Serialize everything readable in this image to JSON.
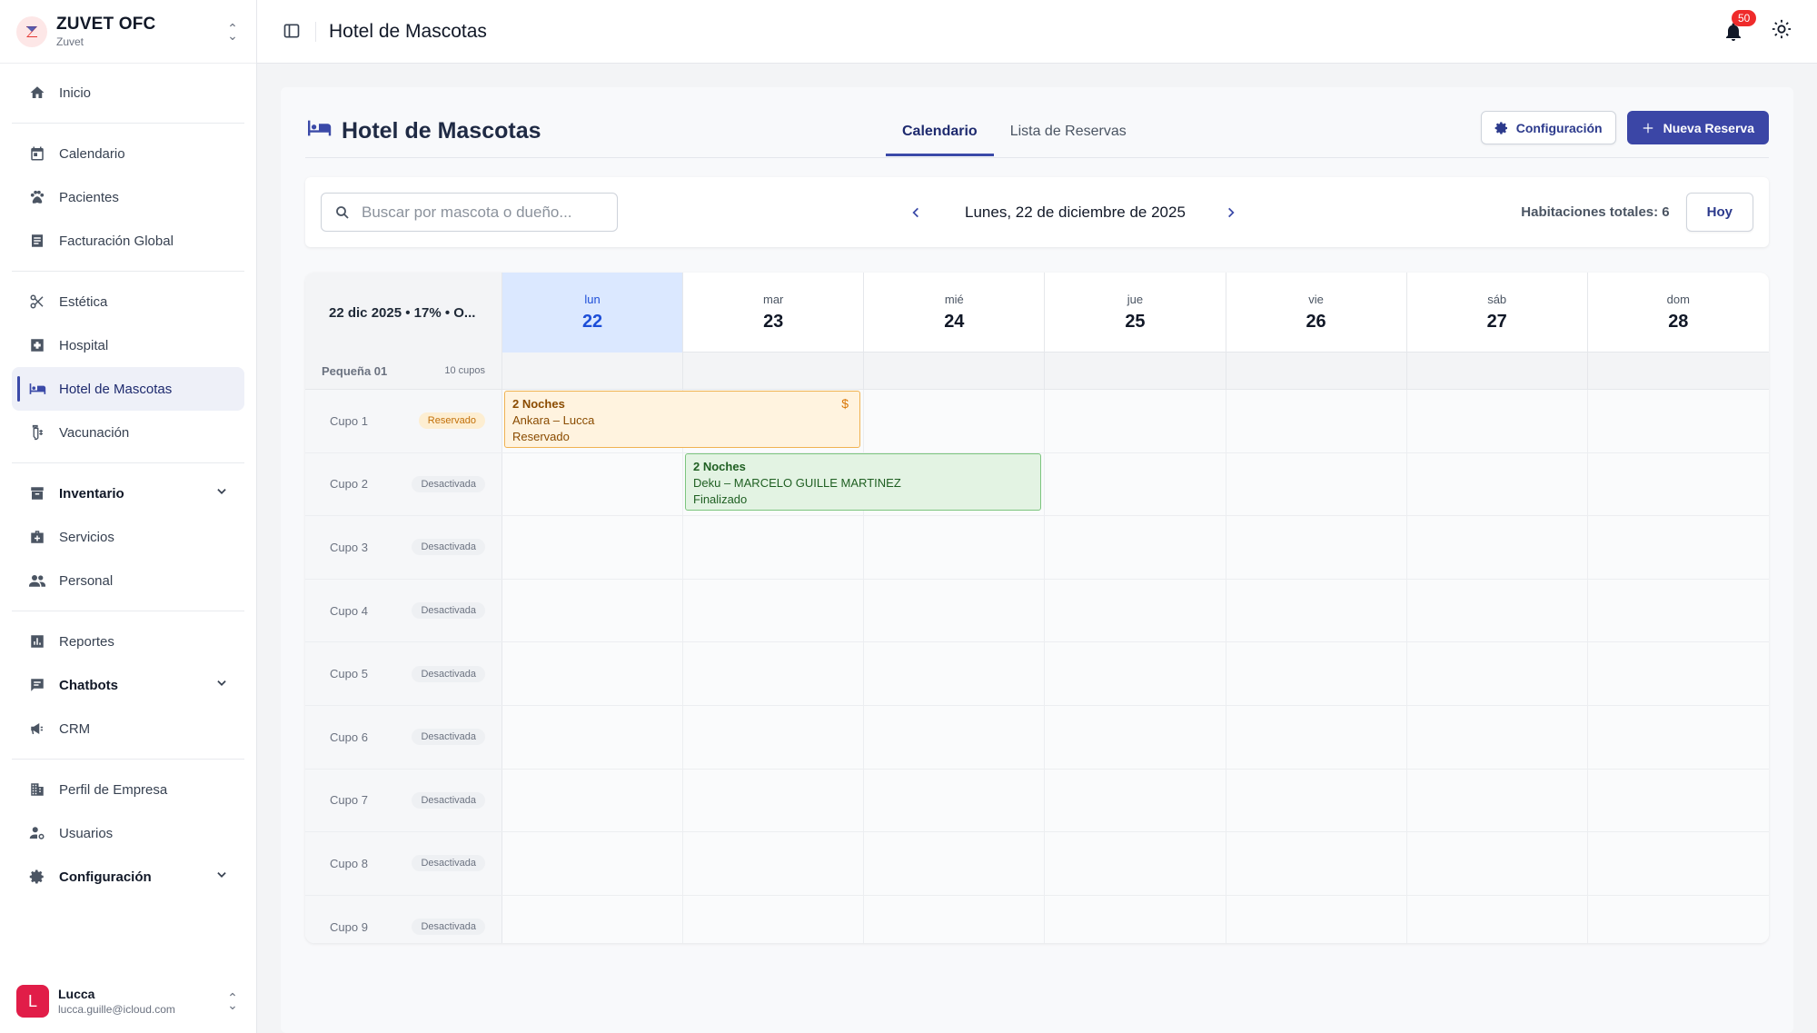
{
  "brand": {
    "title": "ZUVET OFC",
    "subtitle": "Zuvet"
  },
  "topbar": {
    "title": "Hotel de Mascotas",
    "notifications": "50"
  },
  "sidebar": {
    "items": [
      {
        "label": "Inicio",
        "icon": "home-icon"
      },
      {
        "label": "Calendario",
        "icon": "calendar-icon"
      },
      {
        "label": "Pacientes",
        "icon": "paw-icon"
      },
      {
        "label": "Facturación Global",
        "icon": "receipt-icon"
      },
      {
        "label": "Estética",
        "icon": "scissors-icon"
      },
      {
        "label": "Hospital",
        "icon": "hospital-icon"
      },
      {
        "label": "Hotel de Mascotas",
        "icon": "bed-icon"
      },
      {
        "label": "Vacunación",
        "icon": "syringe-icon"
      },
      {
        "label": "Inventario",
        "icon": "inventory-icon"
      },
      {
        "label": "Servicios",
        "icon": "medkit-icon"
      },
      {
        "label": "Personal",
        "icon": "people-icon"
      },
      {
        "label": "Reportes",
        "icon": "chart-icon"
      },
      {
        "label": "Chatbots",
        "icon": "chat-icon"
      },
      {
        "label": "CRM",
        "icon": "megaphone-icon"
      },
      {
        "label": "Perfil de Empresa",
        "icon": "building-icon"
      },
      {
        "label": "Usuarios",
        "icon": "user-settings-icon"
      },
      {
        "label": "Configuración",
        "icon": "gear-icon"
      }
    ]
  },
  "user": {
    "initial": "L",
    "name": "Lucca",
    "email": "lucca.guille@icloud.com"
  },
  "page": {
    "title": "Hotel de Mascotas",
    "tabs": [
      "Calendario",
      "Lista de Reservas"
    ],
    "config_button": "Configuración",
    "new_button": "Nueva Reserva"
  },
  "toolbar": {
    "search_placeholder": "Buscar por mascota o dueño...",
    "date": "Lunes, 22 de diciembre de 2025",
    "totals": "Habitaciones totales: 6",
    "today_button": "Hoy"
  },
  "calendar": {
    "corner": "22 dic 2025 • 17% • O...",
    "days": [
      {
        "name": "lun",
        "num": "22"
      },
      {
        "name": "mar",
        "num": "23"
      },
      {
        "name": "mié",
        "num": "24"
      },
      {
        "name": "jue",
        "num": "25"
      },
      {
        "name": "vie",
        "num": "26"
      },
      {
        "name": "sáb",
        "num": "27"
      },
      {
        "name": "dom",
        "num": "28"
      }
    ],
    "group": {
      "name": "Pequeña 01",
      "count": "10 cupos"
    },
    "rows": [
      {
        "label": "Cupo 1",
        "status": "Reservado"
      },
      {
        "label": "Cupo 2",
        "status": "Desactivada"
      },
      {
        "label": "Cupo 3",
        "status": "Desactivada"
      },
      {
        "label": "Cupo 4",
        "status": "Desactivada"
      },
      {
        "label": "Cupo 5",
        "status": "Desactivada"
      },
      {
        "label": "Cupo 6",
        "status": "Desactivada"
      },
      {
        "label": "Cupo 7",
        "status": "Desactivada"
      },
      {
        "label": "Cupo 8",
        "status": "Desactivada"
      },
      {
        "label": "Cupo 9",
        "status": "Desactivada"
      }
    ],
    "bookings": [
      {
        "nights": "2 Noches",
        "pet": "Ankara – Lucca",
        "status": "Reservado",
        "symbol": "$"
      },
      {
        "nights": "2 Noches",
        "pet": "Deku – MARCELO GUILLE MARTINEZ",
        "status": "Finalizado"
      }
    ]
  },
  "colors": {
    "accent": "#3b46a6",
    "today": "#dbe8ff",
    "reserved": "#fff3df",
    "finished": "#e3f3e3"
  }
}
